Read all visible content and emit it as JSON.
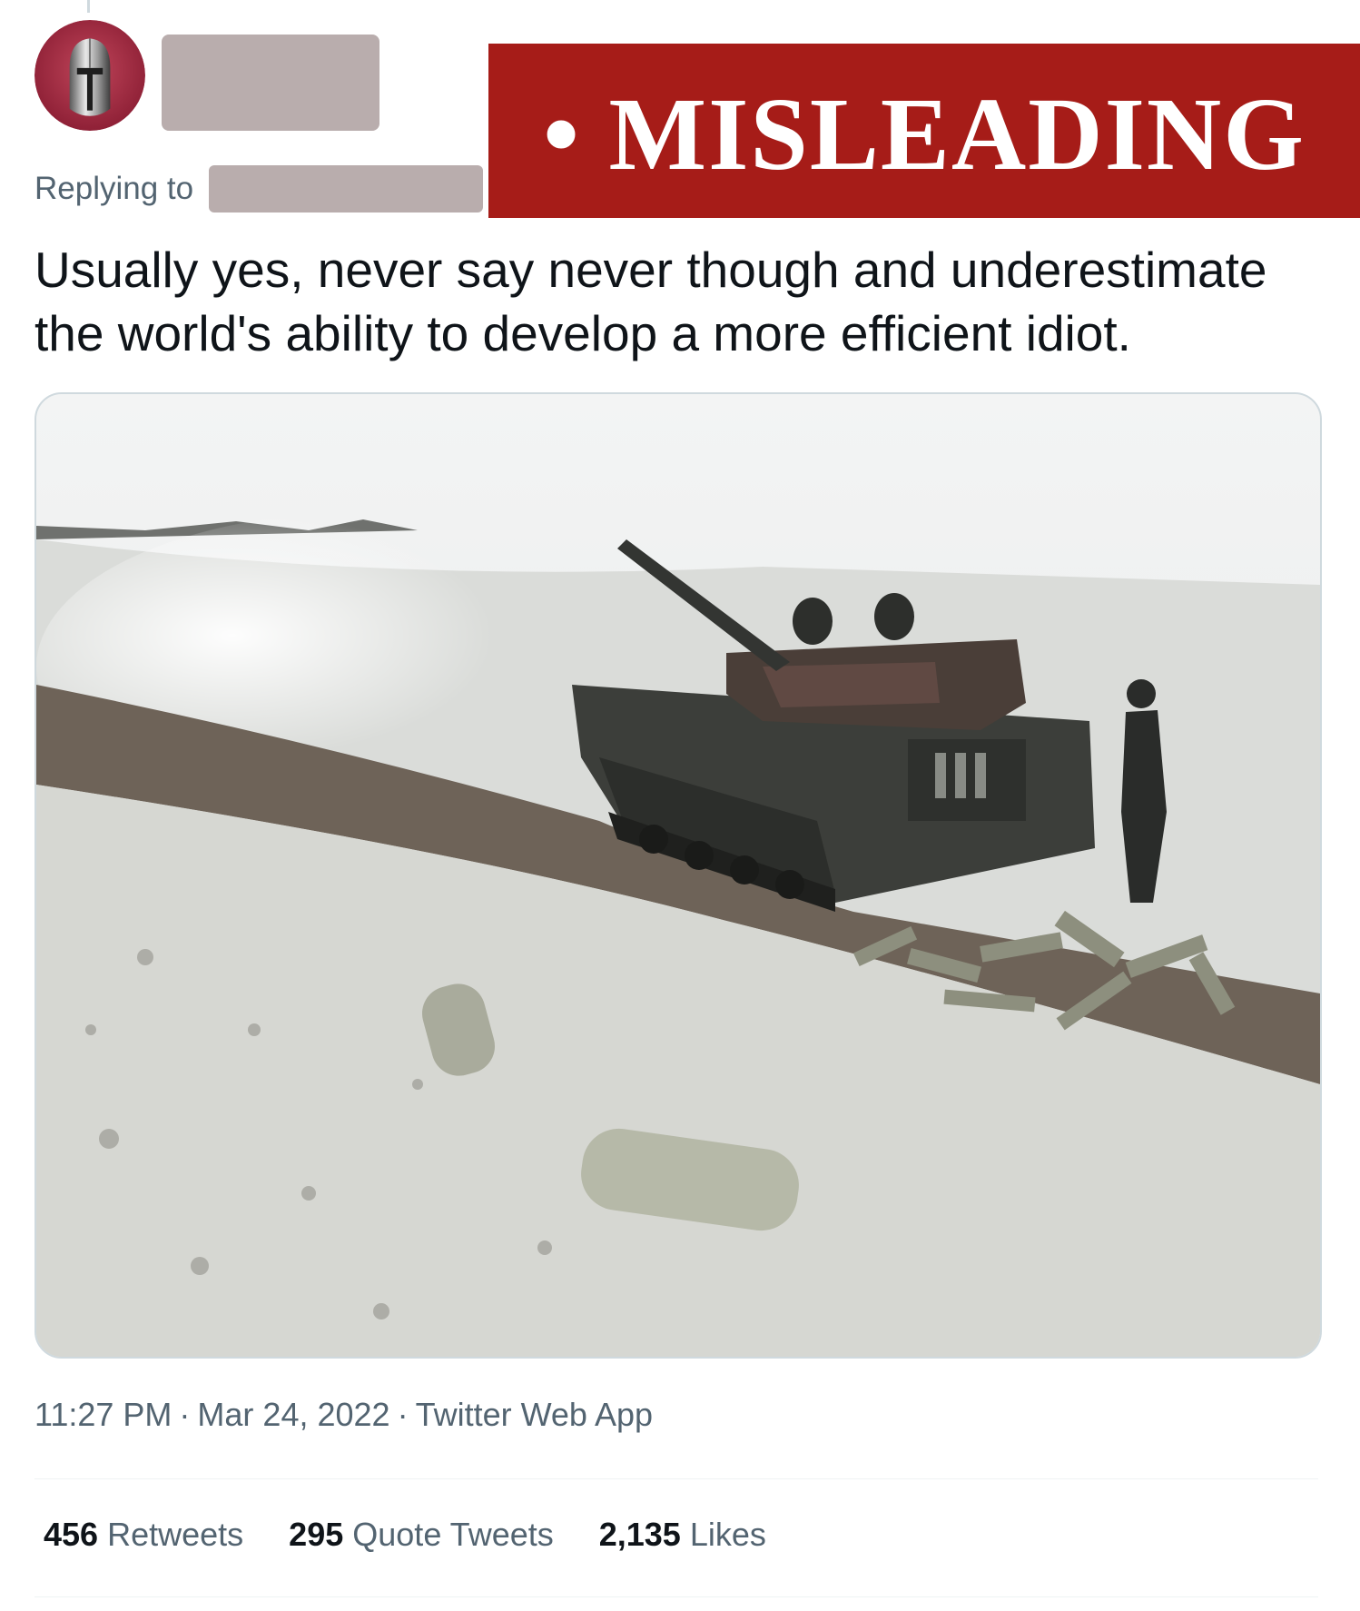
{
  "label": {
    "text": "• MISLEADING",
    "color": "#a61c18"
  },
  "reply": {
    "prefix": "Replying to"
  },
  "tweet": {
    "text": "Usually yes, never say never though and underestimate the world's ability to develop a more efficient idiot.",
    "time": "11:27 PM",
    "date": "Mar 24, 2022",
    "source": "Twitter Web App",
    "separator": "·"
  },
  "stats": {
    "retweets": {
      "count": "456",
      "label": "Retweets"
    },
    "quotes": {
      "count": "295",
      "label": "Quote Tweets"
    },
    "likes": {
      "count": "2,135",
      "label": "Likes"
    }
  },
  "colors": {
    "text": "#0f1419",
    "muted": "#536471",
    "border": "#cfd9de"
  }
}
